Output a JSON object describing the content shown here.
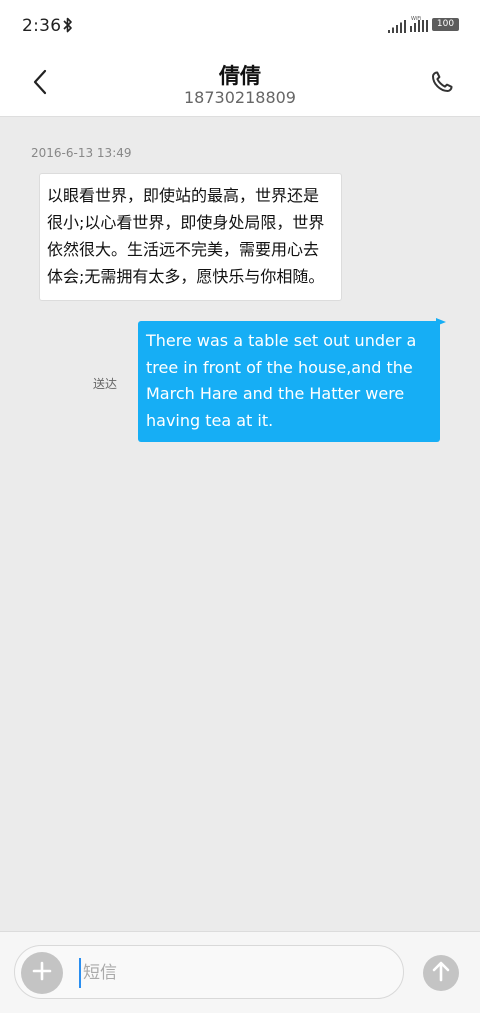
{
  "status_bar": {
    "time": "2:36",
    "wifi_label": "WiFi",
    "battery": "100",
    "icons": [
      "bluetooth-icon",
      "signal-icon",
      "wifi-icon",
      "battery-icon"
    ]
  },
  "header": {
    "contact_name": "倩倩",
    "contact_number": "18730218809",
    "icons": [
      "back-arrow-icon",
      "phone-icon"
    ]
  },
  "conversation": {
    "timestamp": "2016-6-13 13:49",
    "messages": [
      {
        "direction": "incoming",
        "text": "以眼看世界，即使站的最高，世界还是很小;以心看世界，即使身处局限，世界依然很大。生活远不完美，需要用心去体会;无需拥有太多，愿快乐与你相随。"
      },
      {
        "direction": "outgoing",
        "text": "There was a table set out under a tree in front of the house,and the March Hare and the Hatter were having tea at it.",
        "status": "送达"
      }
    ]
  },
  "composer": {
    "placeholder": "短信",
    "value": "",
    "icons": [
      "plus-icon",
      "send-arrow-icon"
    ]
  },
  "colors": {
    "outgoing_bubble": "#16aef5",
    "chat_background": "#ebebeb",
    "header_background": "#ffffff",
    "button_gray": "#c4c4c4"
  }
}
